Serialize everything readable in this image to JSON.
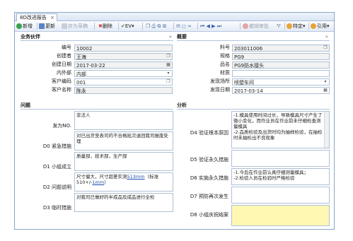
{
  "tab": {
    "title": "8D改进报告",
    "close": "×"
  },
  "toolbar": {
    "new": "新增",
    "refresh": "更新",
    "save_draft": "存为草稿",
    "delete": "删除",
    "ev": "EV▾",
    "withdraw": "撤销审批",
    "specific": "特定▾",
    "cite": "引用▾"
  },
  "partner": {
    "title": "业务伙伴",
    "chev": "»",
    "fields": [
      {
        "label": "编号",
        "value": "10002"
      },
      {
        "label": "创建者",
        "value": "王海"
      },
      {
        "label": "创建日期",
        "value": "2017-03-22"
      },
      {
        "label": "内外部",
        "value": "内部"
      },
      {
        "label": "客户编码",
        "value": "001"
      },
      {
        "label": "客户名称",
        "value": "陈永"
      }
    ]
  },
  "overview": {
    "title": "概要",
    "chev": "»",
    "fields": [
      {
        "label": "料号",
        "value": "203011006"
      },
      {
        "label": "规格",
        "value": "PG9"
      },
      {
        "label": "品名",
        "value": "PG9防水接头"
      },
      {
        "label": "材质",
        "value": ""
      },
      {
        "label": "发现场所",
        "value": "喷塑车间"
      },
      {
        "label": "发现日期",
        "value": "2017-03-14"
      }
    ]
  },
  "problem": {
    "title": "问题",
    "items": [
      {
        "label": "发为NO.",
        "text": "非法人"
      },
      {
        "label": "D0 紧急措施",
        "text": "对已出货至表司的不合格批次退回我司报废处理"
      },
      {
        "label": "D1 小组成立",
        "text": "质量部，技术部，生产部"
      },
      {
        "label": "D2 问题说明",
        "text_a": "尺寸偏大，尺寸超差实测",
        "text_u": "513mm",
        "text_b": "（标准510+/-",
        "text_u2": "1mm",
        "text_c": "）"
      },
      {
        "label": "D3 临时措施",
        "text": "对我司已做好的半成品及成品进行全检"
      }
    ]
  },
  "analysis": {
    "title": "分析",
    "items": [
      {
        "label": "D4 验证根本原因",
        "text": "-1.模具使用时间过长，导致模具尺寸产生了微小变化，而作业员在作业前未仔细检查测量模具\n-2.品质检验及出货时均为抽样检验，在抽检时未抽检出不良现象"
      },
      {
        "label": "D5 验证永久措施",
        "text": ""
      },
      {
        "label": "D6 实施永久措施",
        "text": "-1.今后在作业前认真仔细测量模具；\n-2.检验人员在检验时严格检验"
      },
      {
        "label": "D7 预防再次发生",
        "text": ""
      },
      {
        "label": "D8 小组庆祝结案",
        "text": ""
      }
    ]
  }
}
